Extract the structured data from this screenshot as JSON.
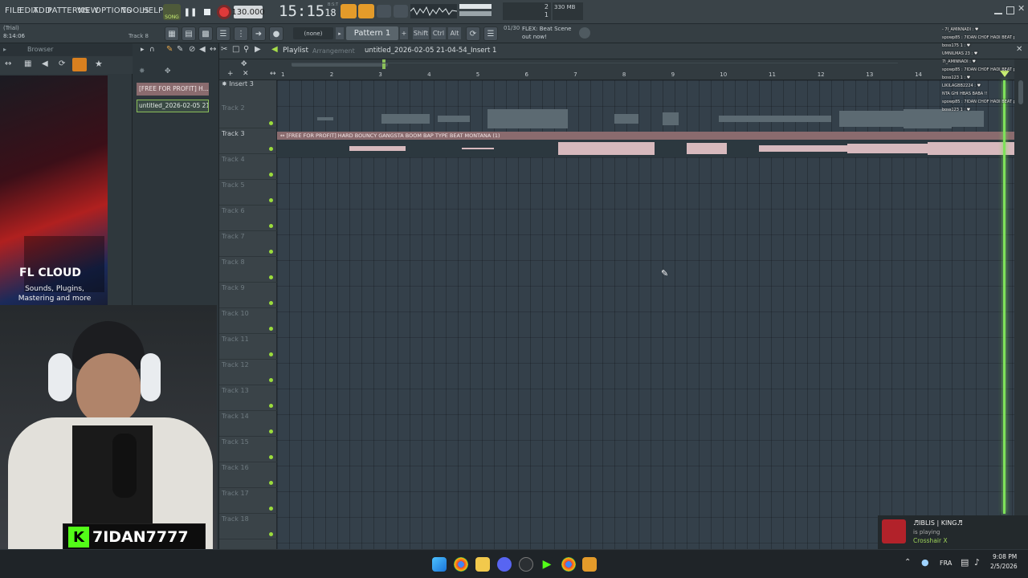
{
  "app": {
    "menu": [
      "FILE",
      "EDIT",
      "ADD",
      "PATTERNS",
      "VIEW",
      "OPTIONS",
      "TOOLS",
      "HELP"
    ],
    "mode": "SONG",
    "tempo": "130.000",
    "time": "15:15",
    "time_sub": "18",
    "time_label": "B:S:T",
    "cpu_top": "2",
    "cpu_bottom": "1",
    "mem": "330 MB",
    "pattern": "Pattern 1",
    "snap": "(none)",
    "news_counter": "01/30",
    "news_text": "FLEX: Beat Scene out now!",
    "trial_label": "(Trial)",
    "trial_time": "8:14:06",
    "trial_track": "Track 8",
    "modifier_keys": [
      "Shift",
      "Ctrl",
      "Alt"
    ]
  },
  "browser": {
    "title": "Browser",
    "promo_title": "FL CLOUD",
    "promo_sub": "Sounds, Plugins, Mastering and more"
  },
  "picker": {
    "items": [
      "[FREE FOR PROFIT] H...",
      "untitled_2026-02-05 21-..."
    ]
  },
  "playlist": {
    "title": "Playlist",
    "subtitle": "Arrangement",
    "breadcrumb": "untitled_2026-02-05 21-04-54_Insert 1",
    "ruler": [
      "1",
      "2",
      "3",
      "4",
      "5",
      "6",
      "7",
      "8",
      "9",
      "10",
      "11",
      "12",
      "13",
      "14"
    ],
    "insert_label": "Insert 3",
    "tracks": [
      "Track 2",
      "Track 3",
      "Track 4",
      "Track 5",
      "Track 6",
      "Track 7",
      "Track 8",
      "Track 9",
      "Track 10",
      "Track 11",
      "Track 12",
      "Track 13",
      "Track 14",
      "Track 15",
      "Track 16",
      "Track 17",
      "Track 18"
    ],
    "clip_label": "↔ [FREE FOR PROFIT] HARD BOUNCY GANGSTA BOOM BAP TYPE BEAT MONTANA (1)"
  },
  "stream": {
    "handle": "7IDAN7777",
    "notif_name": "♬IBLIS | KING♬",
    "notif_status": "is playing",
    "notif_game": "Crosshair X",
    "chat": [
      "- 7I_AMINNADI : ♥",
      "spowp85 : 7IDAN CHOF HADI BEAT pa",
      "boss175 1 : ♥",
      "UMNILMAS 23 : ♥",
      "7I_AMINNADI : ♥",
      "spowp85 : 7IDAN CHOF HADI BEAT pa",
      "boss123 1 : ♥",
      "LIKILAGBB2224 : ♥",
      "NTA GHI HBAS BABA !!",
      "spowp85 : 7IDAN CHOF HADI BEAT pa",
      "boss123 1 : ♥"
    ]
  },
  "taskbar": {
    "lang": "FRA",
    "clock": "9:08 PM",
    "date": "2/5/2026"
  },
  "colors": {
    "accent_green": "#7ee15a",
    "clip_header": "#c7a2a6",
    "record_red": "#e03a3a"
  }
}
